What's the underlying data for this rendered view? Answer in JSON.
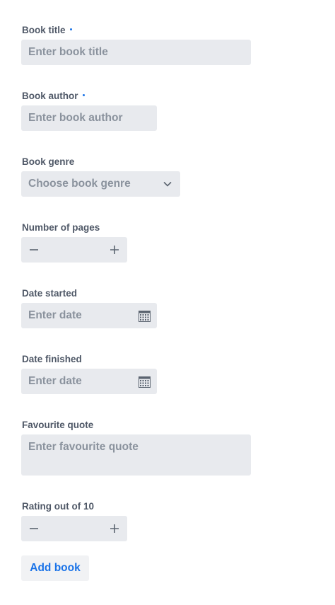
{
  "fields": {
    "title": {
      "label": "Book title",
      "placeholder": "Enter book title"
    },
    "author": {
      "label": "Book author",
      "placeholder": "Enter book author"
    },
    "genre": {
      "label": "Book genre",
      "placeholder": "Choose book genre"
    },
    "pages": {
      "label": "Number of pages"
    },
    "date_started": {
      "label": "Date started",
      "placeholder": "Enter date"
    },
    "date_finished": {
      "label": "Date finished",
      "placeholder": "Enter date"
    },
    "quote": {
      "label": "Favourite quote",
      "placeholder": "Enter favourite quote"
    },
    "rating": {
      "label": "Rating out of 10"
    }
  },
  "actions": {
    "submit_label": "Add book"
  },
  "colors": {
    "accent": "#1a73e8",
    "field_bg": "#e8eaee",
    "label": "#4f5867",
    "placeholder": "#8a929d"
  }
}
